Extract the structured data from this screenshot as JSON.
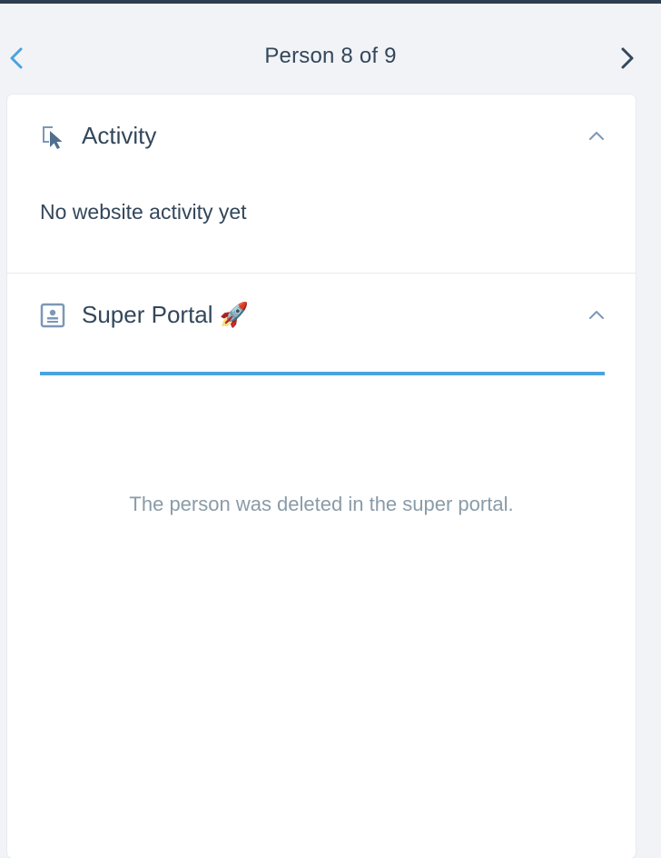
{
  "nav": {
    "title": "Person 8 of 9"
  },
  "activity": {
    "title": "Activity",
    "empty_text": "No website activity yet"
  },
  "super_portal": {
    "title": "Super Portal 🚀",
    "progress_percent": 100,
    "message": "The person was deleted in the super portal."
  },
  "colors": {
    "accent": "#4aa3df",
    "text": "#33475b",
    "muted": "#8a9ba8"
  }
}
